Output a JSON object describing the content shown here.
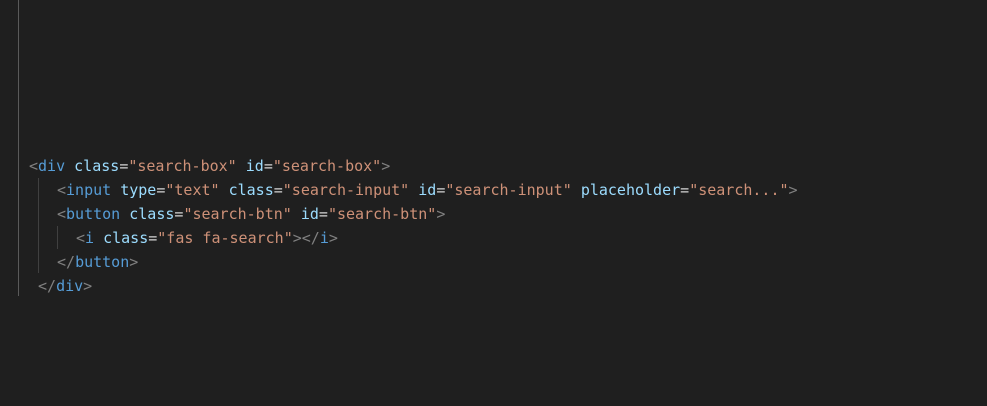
{
  "colors": {
    "background": "#1f1f1f",
    "tag_bracket": "#808080",
    "tag_name": "#569cd6",
    "attr_name": "#9cdcfe",
    "attr_value": "#ce9178",
    "text": "#d4d4d4"
  },
  "code": {
    "line1": {
      "open": "<",
      "tag": "div",
      "a1_name": "class",
      "a1_val": "\"search-box\"",
      "a2_name": "id",
      "a2_val": "\"search-box\"",
      "close": ">"
    },
    "line2": {
      "open": "<",
      "tag": "input",
      "a1_name": "type",
      "a1_val": "\"text\"",
      "a2_name": "class",
      "a2_val": "\"search-input\"",
      "a3_name": "id",
      "a3_val": "\"search-input\"",
      "a4_name": "placeholder",
      "a4_val": "\"search...\"",
      "close": ">"
    },
    "line3": {
      "open": "<",
      "tag": "button",
      "a1_name": "class",
      "a1_val": "\"search-btn\"",
      "a2_name": "id",
      "a2_val": "\"search-btn\"",
      "close": ">"
    },
    "line4": {
      "open": "<",
      "tag": "i",
      "a1_name": "class",
      "a1_val": "\"fas fa-search\"",
      "close": ">",
      "end_open": "</",
      "end_tag": "i",
      "end_close": ">"
    },
    "line5": {
      "open": "</",
      "tag": "button",
      "close": ">"
    },
    "line6": {
      "open": "</",
      "tag": "div",
      "close": ">"
    }
  }
}
